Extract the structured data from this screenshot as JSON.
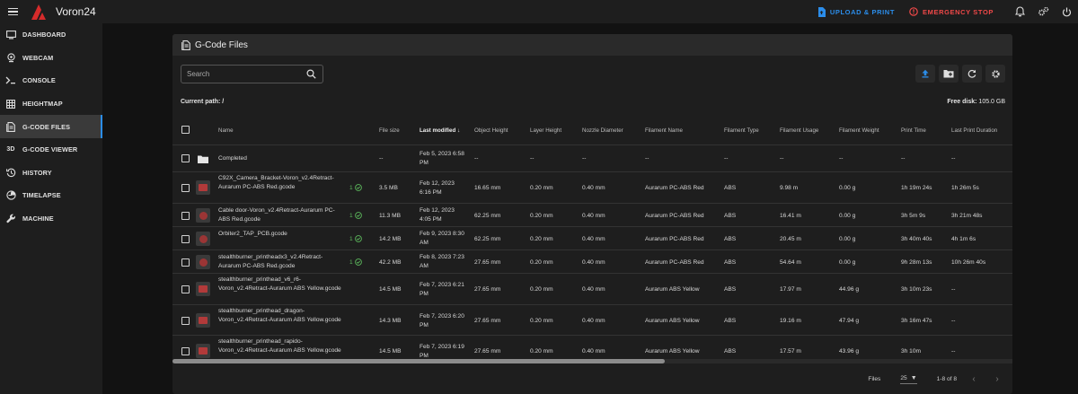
{
  "app": {
    "title": "Voron24"
  },
  "topbar": {
    "upload_label": "UPLOAD & PRINT",
    "estop_label": "EMERGENCY STOP"
  },
  "sidebar": {
    "items": [
      {
        "label": "DASHBOARD",
        "icon": "dashboard-icon"
      },
      {
        "label": "WEBCAM",
        "icon": "webcam-icon"
      },
      {
        "label": "CONSOLE",
        "icon": "console-icon"
      },
      {
        "label": "HEIGHTMAP",
        "icon": "grid-icon"
      },
      {
        "label": "G-CODE FILES",
        "icon": "file-icon",
        "active": true
      },
      {
        "label": "G-CODE VIEWER",
        "icon": "3d-icon",
        "glyph": "3D"
      },
      {
        "label": "HISTORY",
        "icon": "history-icon"
      },
      {
        "label": "TIMELAPSE",
        "icon": "timelapse-icon"
      },
      {
        "label": "MACHINE",
        "icon": "wrench-icon"
      }
    ]
  },
  "panel": {
    "title": "G-Code Files",
    "search_placeholder": "Search",
    "current_path_label": "Current path: /",
    "free_disk_label": "Free disk:",
    "free_disk_value": "105.0 GB"
  },
  "table": {
    "headers": {
      "name": "Name",
      "size": "File size",
      "modified": "Last modified",
      "object_height": "Object Height",
      "layer_height": "Layer Height",
      "nozzle": "Nozzle Diameter",
      "filament_name": "Filament Name",
      "filament_type": "Filament Type",
      "filament_usage": "Filament Usage",
      "filament_weight": "Filament Weight",
      "print_time": "Print Time",
      "last_duration": "Last Print Duration"
    },
    "rows": [
      {
        "type": "folder",
        "name": "Completed",
        "size": "--",
        "modified": "Feb 5, 2023 6:58 PM",
        "object_height": "--",
        "layer_height": "--",
        "nozzle": "--",
        "filament_name": "--",
        "filament_type": "--",
        "filament_usage": "--",
        "filament_weight": "--",
        "print_time": "--",
        "last_duration": "--"
      },
      {
        "type": "file",
        "name": "C92X_Camera_Bracket-Voron_v2.4Retract-Aurarum PC-ABS Red.gcode",
        "count": "1",
        "size": "3.5 MB",
        "modified": "Feb 12, 2023 6:16 PM",
        "object_height": "16.65 mm",
        "layer_height": "0.20 mm",
        "nozzle": "0.40 mm",
        "filament_name": "Aurarum PC-ABS Red",
        "filament_type": "ABS",
        "filament_usage": "9.98 m",
        "filament_weight": "0.00 g",
        "print_time": "1h 19m 24s",
        "last_duration": "1h 26m 5s"
      },
      {
        "type": "file",
        "name": "Cable door-Voron_v2.4Retract-Aurarum PC-ABS Red.gcode",
        "count": "1",
        "size": "11.3 MB",
        "modified": "Feb 12, 2023 4:05 PM",
        "object_height": "62.25 mm",
        "layer_height": "0.20 mm",
        "nozzle": "0.40 mm",
        "filament_name": "Aurarum PC-ABS Red",
        "filament_type": "ABS",
        "filament_usage": "16.41 m",
        "filament_weight": "0.00 g",
        "print_time": "3h 5m 9s",
        "last_duration": "3h 21m 48s"
      },
      {
        "type": "file",
        "name": "Orbiter2_TAP_PCB.gcode",
        "count": "1",
        "size": "14.2 MB",
        "modified": "Feb 9, 2023 8:30 AM",
        "object_height": "62.25 mm",
        "layer_height": "0.20 mm",
        "nozzle": "0.40 mm",
        "filament_name": "Aurarum PC-ABS Red",
        "filament_type": "ABS",
        "filament_usage": "20.45 m",
        "filament_weight": "0.00 g",
        "print_time": "3h 40m 40s",
        "last_duration": "4h 1m 6s"
      },
      {
        "type": "file",
        "name": "stealthburner_printheadx3_v2.4Retract-Aurarum PC-ABS Red.gcode",
        "count": "1",
        "size": "42.2 MB",
        "modified": "Feb 8, 2023 7:23 AM",
        "object_height": "27.65 mm",
        "layer_height": "0.20 mm",
        "nozzle": "0.40 mm",
        "filament_name": "Aurarum PC-ABS Red",
        "filament_type": "ABS",
        "filament_usage": "54.64 m",
        "filament_weight": "0.00 g",
        "print_time": "9h 28m 13s",
        "last_duration": "10h 26m 40s"
      },
      {
        "type": "file",
        "name": "stealthburner_printhead_v6_r6-Voron_v2.4Retract-Aurarum ABS Yellow.gcode",
        "count": "",
        "size": "14.5 MB",
        "modified": "Feb 7, 2023 6:21 PM",
        "object_height": "27.65 mm",
        "layer_height": "0.20 mm",
        "nozzle": "0.40 mm",
        "filament_name": "Aurarum ABS Yellow",
        "filament_type": "ABS",
        "filament_usage": "17.97 m",
        "filament_weight": "44.96 g",
        "print_time": "3h 10m 23s",
        "last_duration": "--"
      },
      {
        "type": "file",
        "name": "stealthburner_printhead_dragon-Voron_v2.4Retract-Aurarum ABS Yellow.gcode",
        "count": "",
        "size": "14.3 MB",
        "modified": "Feb 7, 2023 6:20 PM",
        "object_height": "27.65 mm",
        "layer_height": "0.20 mm",
        "nozzle": "0.40 mm",
        "filament_name": "Aurarum ABS Yellow",
        "filament_type": "ABS",
        "filament_usage": "19.16 m",
        "filament_weight": "47.94 g",
        "print_time": "3h 16m 47s",
        "last_duration": "--"
      },
      {
        "type": "file",
        "name": "stealthburner_printhead_rapido-Voron_v2.4Retract-Aurarum ABS Yellow.gcode",
        "count": "",
        "size": "14.5 MB",
        "modified": "Feb 7, 2023 6:19 PM",
        "object_height": "27.65 mm",
        "layer_height": "0.20 mm",
        "nozzle": "0.40 mm",
        "filament_name": "Aurarum ABS Yellow",
        "filament_type": "ABS",
        "filament_usage": "17.57 m",
        "filament_weight": "43.96 g",
        "print_time": "3h 10m",
        "last_duration": "--"
      }
    ]
  },
  "footer": {
    "files_label": "Files",
    "per_page": "25",
    "range": "1-8 of 8"
  },
  "colors": {
    "accent": "#2b8dea",
    "danger": "#ef4848",
    "success": "#5cb85c"
  }
}
